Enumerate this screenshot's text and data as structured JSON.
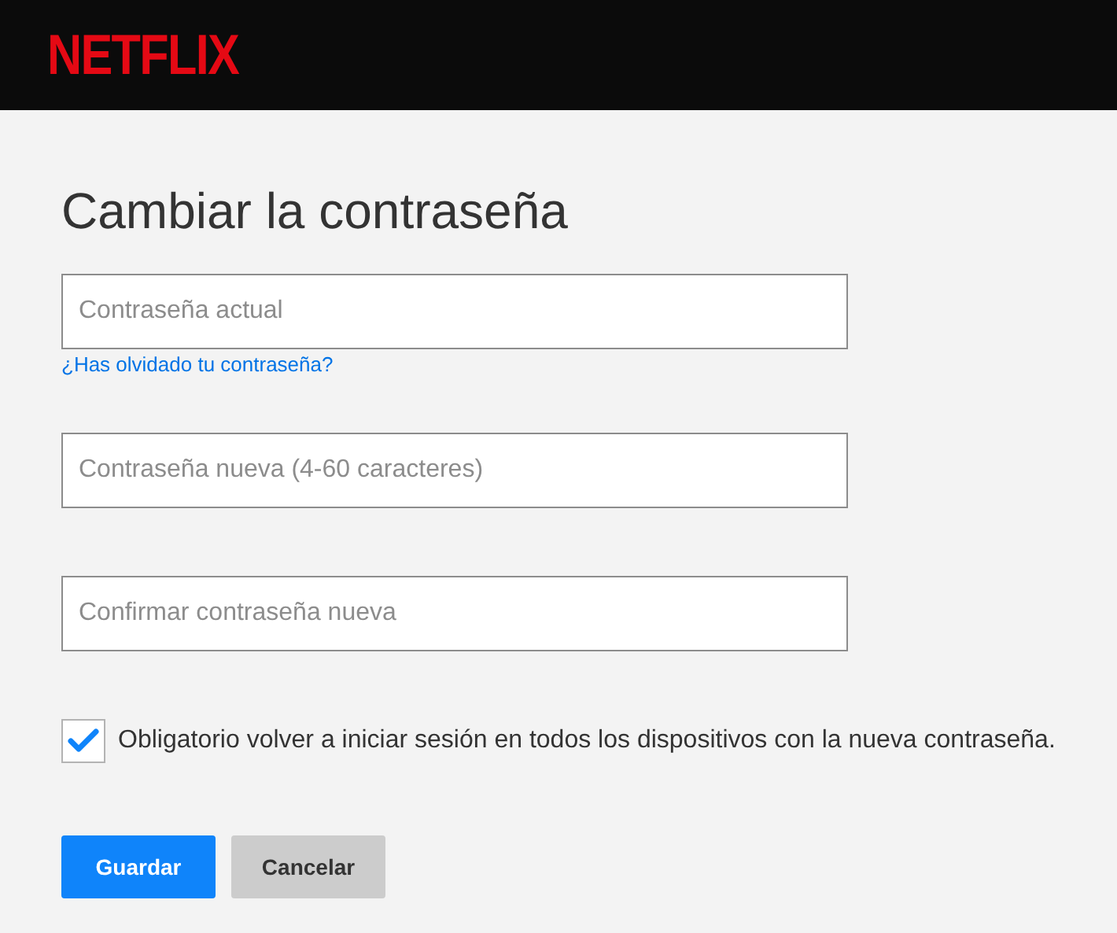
{
  "header": {
    "logo": "NETFLIX"
  },
  "title": "Cambiar la contraseña",
  "fields": [
    {
      "placeholder": "Contraseña actual",
      "link": "¿Has olvidado tu contraseña?"
    },
    {
      "placeholder": "Contraseña nueva (4-60 caracteres)"
    },
    {
      "placeholder": "Confirmar contraseña nueva"
    }
  ],
  "checkbox": {
    "label": "Obligatorio volver a iniciar sesión en todos los dispositivos con la nueva contraseña.",
    "checked": true
  },
  "buttons": [
    {
      "label": "Guardar",
      "kind": "primary"
    },
    {
      "label": "Cancelar",
      "kind": "secondary"
    }
  ]
}
